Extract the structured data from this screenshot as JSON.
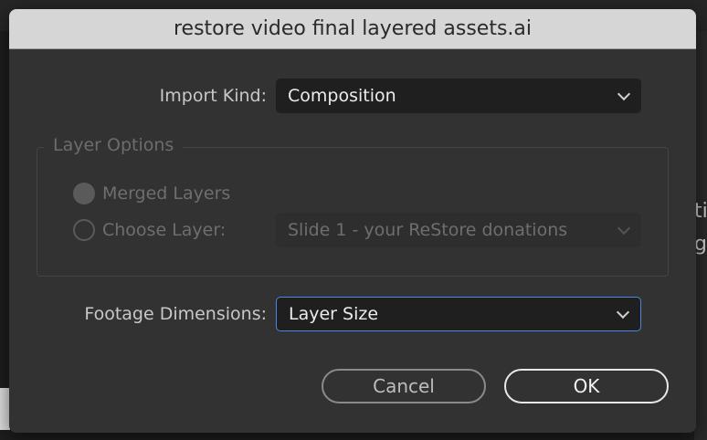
{
  "background": {
    "right_text": "ti\nge"
  },
  "dialog": {
    "title": "restore video final layered assets.ai",
    "import_kind": {
      "label": "Import Kind:",
      "value": "Composition"
    },
    "layer_options": {
      "legend": "Layer Options",
      "merged_layers": "Merged Layers",
      "choose_layer": "Choose Layer:",
      "layer_value": "Slide 1 - your ReStore donations"
    },
    "footage_dimensions": {
      "label": "Footage Dimensions:",
      "value": "Layer Size"
    },
    "buttons": {
      "cancel": "Cancel",
      "ok": "OK"
    }
  }
}
